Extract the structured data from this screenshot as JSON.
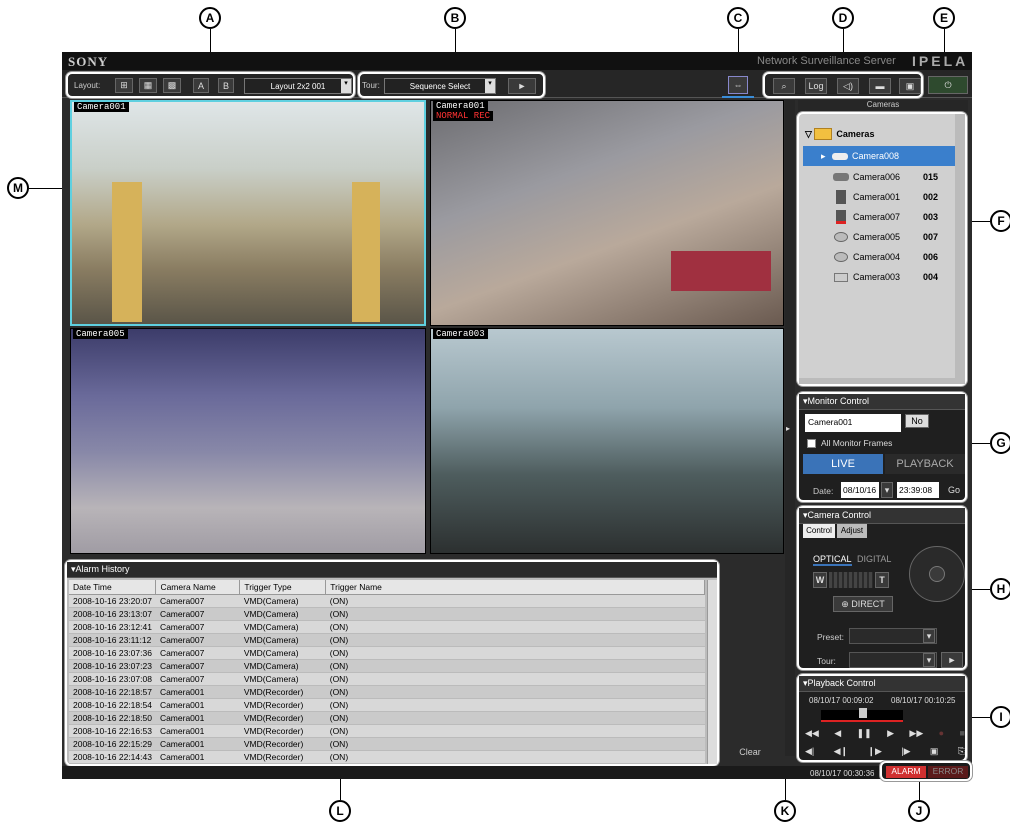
{
  "callouts": [
    "A",
    "B",
    "C",
    "D",
    "E",
    "F",
    "G",
    "H",
    "I",
    "J",
    "K",
    "L",
    "M"
  ],
  "header": {
    "brand": "SONY",
    "product": "Network Surveillance Server",
    "logo": "IPELA"
  },
  "toolbar": {
    "layout_label": "Layout:",
    "layout_value": "Layout 2x2 001",
    "tour_label": "Tour:",
    "tour_value": "Sequence Select",
    "layout_a": "A",
    "layout_b": "B",
    "log_label": "Log"
  },
  "cameras_header": "Cameras",
  "views": [
    {
      "label": "Camera001"
    },
    {
      "label": "Camera001",
      "rec": "NORMAL REC"
    },
    {
      "label": "Camera005"
    },
    {
      "label": "Camera003"
    }
  ],
  "tree": {
    "root": "Cameras",
    "items": [
      {
        "name": "Camera008",
        "num": ""
      },
      {
        "name": "Camera006",
        "num": "015"
      },
      {
        "name": "Camera001",
        "num": "002"
      },
      {
        "name": "Camera007",
        "num": "003"
      },
      {
        "name": "Camera005",
        "num": "007"
      },
      {
        "name": "Camera004",
        "num": "006"
      },
      {
        "name": "Camera003",
        "num": "004"
      }
    ]
  },
  "monitor": {
    "title": "Monitor Control",
    "camera": "Camera001",
    "all_frames": "All Monitor Frames",
    "live": "LIVE",
    "playback": "PLAYBACK",
    "date_label": "Date:",
    "date": "08/10/16",
    "time": "23:39:08",
    "go": "Go"
  },
  "camctrl": {
    "title": "Camera Control",
    "tab_control": "Control",
    "tab_adjust": "Adjust",
    "optical": "OPTICAL",
    "digital": "DIGITAL",
    "w": "W",
    "t": "T",
    "direct": "DIRECT",
    "preset": "Preset:",
    "tour": "Tour:"
  },
  "playback": {
    "title": "Playback Control",
    "start": "08/10/17 00:09:02",
    "end": "08/10/17 00:10:25"
  },
  "status": {
    "time": "08/10/17 00:30:36",
    "alarm": "ALARM",
    "error": "ERROR"
  },
  "alarm": {
    "title": "Alarm History",
    "clear": "Clear",
    "columns": [
      "Date Time",
      "Camera Name",
      "Trigger Type",
      "Trigger Name"
    ],
    "rows": [
      [
        "2008-10-16 23:20:07",
        "Camera007",
        "VMD(Camera)",
        "(ON)"
      ],
      [
        "2008-10-16 23:13:07",
        "Camera007",
        "VMD(Camera)",
        "(ON)"
      ],
      [
        "2008-10-16 23:12:41",
        "Camera007",
        "VMD(Camera)",
        "(ON)"
      ],
      [
        "2008-10-16 23:11:12",
        "Camera007",
        "VMD(Camera)",
        "(ON)"
      ],
      [
        "2008-10-16 23:07:36",
        "Camera007",
        "VMD(Camera)",
        "(ON)"
      ],
      [
        "2008-10-16 23:07:23",
        "Camera007",
        "VMD(Camera)",
        "(ON)"
      ],
      [
        "2008-10-16 23:07:08",
        "Camera007",
        "VMD(Camera)",
        "(ON)"
      ],
      [
        "2008-10-16 22:18:57",
        "Camera001",
        "VMD(Recorder)",
        "(ON)"
      ],
      [
        "2008-10-16 22:18:54",
        "Camera001",
        "VMD(Recorder)",
        "(ON)"
      ],
      [
        "2008-10-16 22:18:50",
        "Camera001",
        "VMD(Recorder)",
        "(ON)"
      ],
      [
        "2008-10-16 22:16:53",
        "Camera001",
        "VMD(Recorder)",
        "(ON)"
      ],
      [
        "2008-10-16 22:15:29",
        "Camera001",
        "VMD(Recorder)",
        "(ON)"
      ],
      [
        "2008-10-16 22:14:43",
        "Camera001",
        "VMD(Recorder)",
        "(ON)"
      ]
    ]
  }
}
